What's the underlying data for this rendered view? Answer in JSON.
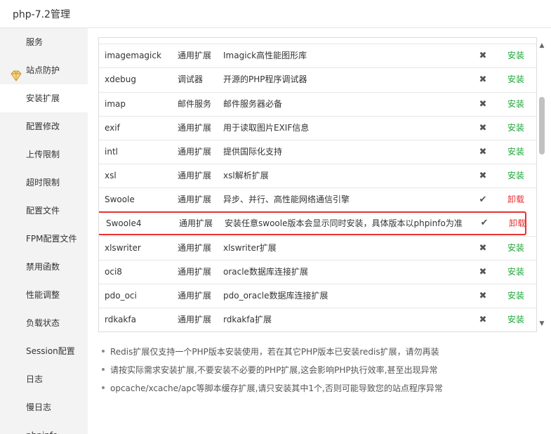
{
  "window": {
    "title": "php-7.2管理"
  },
  "sidebar": {
    "items": [
      {
        "label": "服务",
        "icon": ""
      },
      {
        "label": "站点防护",
        "icon": "shield-gem-icon"
      },
      {
        "label": "安装扩展",
        "active": true
      },
      {
        "label": "配置修改"
      },
      {
        "label": "上传限制"
      },
      {
        "label": "超时限制"
      },
      {
        "label": "配置文件"
      },
      {
        "label": "FPM配置文件"
      },
      {
        "label": "禁用函数"
      },
      {
        "label": "性能调整"
      },
      {
        "label": "负载状态"
      },
      {
        "label": "Session配置"
      },
      {
        "label": "日志"
      },
      {
        "label": "慢日志"
      },
      {
        "label": "phpinfo"
      }
    ]
  },
  "extensions": {
    "rows": [
      {
        "name": "imagemagick",
        "type": "通用扩展",
        "desc": "Imagick高性能图形库",
        "installed": false,
        "action": "安装"
      },
      {
        "name": "xdebug",
        "type": "调试器",
        "desc": "开源的PHP程序调试器",
        "installed": false,
        "action": "安装"
      },
      {
        "name": "imap",
        "type": "邮件服务",
        "desc": "邮件服务器必备",
        "installed": false,
        "action": "安装"
      },
      {
        "name": "exif",
        "type": "通用扩展",
        "desc": "用于读取图片EXIF信息",
        "installed": false,
        "action": "安装"
      },
      {
        "name": "intl",
        "type": "通用扩展",
        "desc": "提供国际化支持",
        "installed": false,
        "action": "安装"
      },
      {
        "name": "xsl",
        "type": "通用扩展",
        "desc": "xsl解析扩展",
        "installed": false,
        "action": "安装"
      },
      {
        "name": "Swoole",
        "type": "通用扩展",
        "desc": "异步、并行、高性能网络通信引擎",
        "installed": true,
        "action": "卸载"
      },
      {
        "name": "Swoole4",
        "type": "通用扩展",
        "desc": "安装任意swoole版本会显示同时安装，具体版本以phpinfo为准",
        "installed": true,
        "action": "卸载",
        "highlighted": true
      },
      {
        "name": "xlswriter",
        "type": "通用扩展",
        "desc": "xlswriter扩展",
        "installed": false,
        "action": "安装"
      },
      {
        "name": "oci8",
        "type": "通用扩展",
        "desc": "oracle数据库连接扩展",
        "installed": false,
        "action": "安装"
      },
      {
        "name": "pdo_oci",
        "type": "通用扩展",
        "desc": "pdo_oracle数据库连接扩展",
        "installed": false,
        "action": "安装"
      },
      {
        "name": "rdkakfa",
        "type": "通用扩展",
        "desc": "rdkakfa扩展",
        "installed": false,
        "action": "安装"
      }
    ],
    "status_glyphs": {
      "installed": "✔",
      "not_installed": "✖"
    }
  },
  "notes": [
    "Redis扩展仅支持一个PHP版本安装使用，若在其它PHP版本已安装redis扩展，请勿再装",
    "请按实际需求安装扩展,不要安装不必要的PHP扩展,这会影响PHP执行效率,甚至出现异常",
    "opcache/xcache/apc等脚本缓存扩展,请只安装其中1个,否则可能导致您的站点程序异常"
  ],
  "colors": {
    "install": "#20a53a",
    "uninstall": "#e53333",
    "highlight_border": "#e53333",
    "sidebar_bg": "#f3f3f3"
  }
}
